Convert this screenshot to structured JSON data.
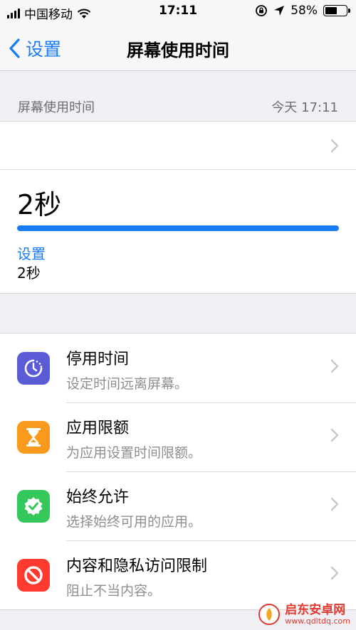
{
  "status_bar": {
    "carrier": "中国移动",
    "time": "17:11",
    "battery_percent": "58%",
    "battery_level": 0.58,
    "icons": [
      "signal-icon",
      "wifi-icon",
      "rotation-lock-icon",
      "location-icon",
      "battery-icon"
    ]
  },
  "nav": {
    "back_label": "设置",
    "title": "屏幕使用时间"
  },
  "section": {
    "header": "屏幕使用时间",
    "date": "今天 17:11"
  },
  "summary": {
    "total_time": "2秒",
    "usage_fraction": 1.0,
    "app_name": "设置",
    "app_time": "2秒"
  },
  "options": [
    {
      "title": "停用时间",
      "subtitle": "设定时间远离屏幕。",
      "icon": "downtime-icon",
      "color": "#5b5bd6"
    },
    {
      "title": "应用限额",
      "subtitle": "为应用设置时间限额。",
      "icon": "hourglass-icon",
      "color": "#f99a1c"
    },
    {
      "title": "始终允许",
      "subtitle": "选择始终可用的应用。",
      "icon": "checkmark-badge-icon",
      "color": "#34c759"
    },
    {
      "title": "内容和隐私访问限制",
      "subtitle": "阻止不当内容。",
      "icon": "prohibited-icon",
      "color": "#ff3b30"
    }
  ],
  "watermark": {
    "name": "启东安卓网",
    "url": "www.qdltdq.com"
  },
  "colors": {
    "accent": "#1a7cf4",
    "background": "#efeff4"
  }
}
